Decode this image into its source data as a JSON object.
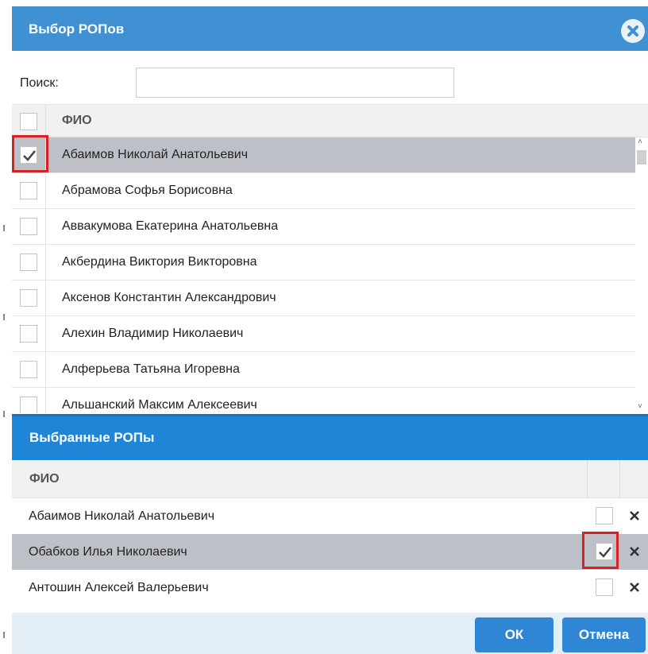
{
  "dialog": {
    "title": "Выбор РОПов",
    "close_icon": "close-icon",
    "colors": {
      "title_bar": "#3f91d4",
      "selected_bar": "#1f85d6",
      "row_selected": "#bdc1c7",
      "highlight": "#d62222",
      "button": "#2f86d5"
    }
  },
  "search": {
    "label": "Поиск:",
    "value": "",
    "placeholder": ""
  },
  "list": {
    "header_fio": "ФИО",
    "select_all_checked": false,
    "rows": [
      {
        "name": "Абаимов Николай Анатольевич",
        "checked": true,
        "selected": true
      },
      {
        "name": "Абрамова Софья Борисовна",
        "checked": false,
        "selected": false
      },
      {
        "name": "Аввакумова Екатерина Анатольевна",
        "checked": false,
        "selected": false
      },
      {
        "name": "Акбердина Виктория Викторовна",
        "checked": false,
        "selected": false
      },
      {
        "name": "Аксенов Константин Александрович",
        "checked": false,
        "selected": false
      },
      {
        "name": "Алехин Владимир Николаевич",
        "checked": false,
        "selected": false
      },
      {
        "name": "Алферьева Татьяна Игоревна",
        "checked": false,
        "selected": false
      },
      {
        "name": "Альшанский Максим Алексеевич",
        "checked": false,
        "selected": false
      }
    ]
  },
  "selected_panel": {
    "title": "Выбранные РОПы",
    "header_fio": "ФИО",
    "rows": [
      {
        "name": "Абаимов Николай Анатольевич",
        "checked": false,
        "selected": false
      },
      {
        "name": "Обабков Илья Николаевич",
        "checked": true,
        "selected": true
      },
      {
        "name": "Антошин Алексей Валерьевич",
        "checked": false,
        "selected": false
      }
    ],
    "remove_icon": "remove-icon"
  },
  "footer": {
    "ok_label": "ОК",
    "cancel_label": "Отмена"
  }
}
